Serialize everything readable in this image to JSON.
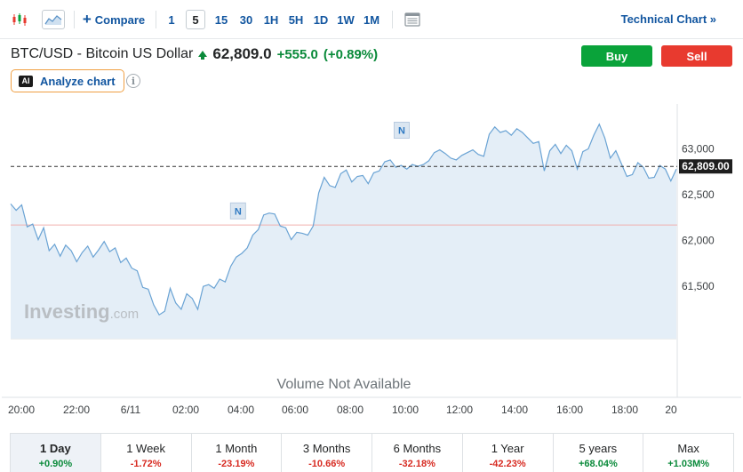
{
  "toolbar": {
    "compare_label": "Compare",
    "intervals": [
      "1",
      "5",
      "15",
      "30",
      "1H",
      "5H",
      "1D",
      "1W",
      "1M"
    ],
    "active_interval": "5",
    "technical_chart_label": "Technical Chart »"
  },
  "header": {
    "instrument": "BTC/USD - Bitcoin US Dollar",
    "price": "62,809.0",
    "change": "+555.0",
    "change_pct": "(+0.89%)",
    "buy_label": "Buy",
    "sell_label": "Sell",
    "analyze_badge": "AI",
    "analyze_label": "Analyze chart",
    "info_glyph": "i"
  },
  "colors": {
    "accent": "#1256a0",
    "up": "#0a8a3a",
    "down": "#d72a21",
    "buy": "#0aa33a",
    "sell": "#e83a2f",
    "line": "#6aa3d4",
    "area": "#e4eef7"
  },
  "chart_data": {
    "type": "area",
    "x_ticks": [
      "20:00",
      "22:00",
      "6/11",
      "02:00",
      "04:00",
      "06:00",
      "08:00",
      "10:00",
      "12:00",
      "14:00",
      "16:00",
      "18:00",
      "20"
    ],
    "y_ticks": [
      61500,
      62000,
      62500,
      63000
    ],
    "y_tick_labels": [
      "61,500",
      "62,000",
      "62,500",
      "63,000"
    ],
    "ylim": [
      60940,
      63490
    ],
    "current_value": 62809.0,
    "current_label": "62,809.00",
    "previous_close": 62170,
    "watermark": "Investing",
    "watermark_suffix": ".com",
    "volume_note": "Volume Not Available",
    "news_markers": [
      {
        "label": "N",
        "x_hours": 8.25,
        "value": 62130
      },
      {
        "label": "N",
        "x_hours": 14.2,
        "value": 63010
      }
    ],
    "series": [
      {
        "x_hours": [
          0,
          0.2,
          0.4,
          0.6,
          0.8,
          1.0,
          1.2,
          1.4,
          1.6,
          1.8,
          2.0,
          2.2,
          2.4,
          2.6,
          2.8,
          3.0,
          3.2,
          3.4,
          3.6,
          3.8,
          4.0,
          4.2,
          4.4,
          4.6,
          4.8,
          5.0,
          5.2,
          5.4,
          5.6,
          5.8,
          6.0,
          6.2,
          6.4,
          6.6,
          6.8,
          7.0,
          7.2,
          7.4,
          7.6,
          7.8,
          8.0,
          8.2,
          8.4,
          8.6,
          8.8,
          9.0,
          9.2,
          9.4,
          9.6,
          9.8,
          10.0,
          10.2,
          10.4,
          10.6,
          10.8,
          11.0,
          11.2,
          11.4,
          11.6,
          11.8,
          12.0,
          12.2,
          12.4,
          12.6,
          12.8,
          13.0,
          13.2,
          13.4,
          13.6,
          13.8,
          14.0,
          14.2,
          14.4,
          14.6,
          14.8,
          15.0,
          15.2,
          15.4,
          15.6,
          15.8,
          16.0,
          16.2,
          16.4,
          16.6,
          16.8,
          17.0,
          17.2,
          17.4,
          17.6,
          17.8,
          18.0,
          18.2,
          18.4,
          18.6,
          18.8,
          19.0,
          19.2,
          19.4,
          19.6,
          19.8,
          20.0,
          20.2,
          20.4,
          20.6,
          20.8,
          21.0,
          21.2,
          21.4,
          21.6,
          21.8,
          22.0,
          22.2,
          22.4,
          22.6,
          22.8,
          23.0,
          23.2,
          23.4,
          23.6,
          23.8,
          24.0,
          24.2
        ],
        "values": [
          62400,
          62330,
          62390,
          62150,
          62180,
          62010,
          62140,
          61890,
          61960,
          61830,
          61950,
          61890,
          61770,
          61870,
          61940,
          61820,
          61900,
          61990,
          61880,
          61920,
          61760,
          61810,
          61700,
          61670,
          61490,
          61470,
          61300,
          61190,
          61230,
          61480,
          61320,
          61250,
          61420,
          61370,
          61250,
          61500,
          61520,
          61480,
          61580,
          61550,
          61720,
          61820,
          61860,
          61920,
          62060,
          62120,
          62280,
          62300,
          62290,
          62160,
          62140,
          62010,
          62090,
          62080,
          62060,
          62160,
          62520,
          62690,
          62600,
          62580,
          62730,
          62770,
          62640,
          62700,
          62710,
          62620,
          62740,
          62760,
          62860,
          62880,
          62800,
          62820,
          62780,
          62830,
          62810,
          62830,
          62870,
          62960,
          62990,
          62950,
          62900,
          62880,
          62930,
          62960,
          62990,
          62940,
          62920,
          63160,
          63240,
          63180,
          63200,
          63150,
          63220,
          63180,
          63120,
          63060,
          63080,
          62760,
          62980,
          63050,
          62950,
          63040,
          62980,
          62780,
          62970,
          63000,
          63150,
          63270,
          63120,
          62900,
          62980,
          62840,
          62700,
          62720,
          62850,
          62800,
          62680,
          62690,
          62820,
          62780,
          62650,
          62780
        ]
      }
    ]
  },
  "periods": [
    {
      "label": "1 Day",
      "value": "+0.90%",
      "trend": "pos",
      "active": true
    },
    {
      "label": "1 Week",
      "value": "-1.72%",
      "trend": "neg",
      "active": false
    },
    {
      "label": "1 Month",
      "value": "-23.19%",
      "trend": "neg",
      "active": false
    },
    {
      "label": "3 Months",
      "value": "-10.66%",
      "trend": "neg",
      "active": false
    },
    {
      "label": "6 Months",
      "value": "-32.18%",
      "trend": "neg",
      "active": false
    },
    {
      "label": "1 Year",
      "value": "-42.23%",
      "trend": "neg",
      "active": false
    },
    {
      "label": "5 years",
      "value": "+68.04%",
      "trend": "pos",
      "active": false
    },
    {
      "label": "Max",
      "value": "+1.03M%",
      "trend": "pos",
      "active": false
    }
  ]
}
